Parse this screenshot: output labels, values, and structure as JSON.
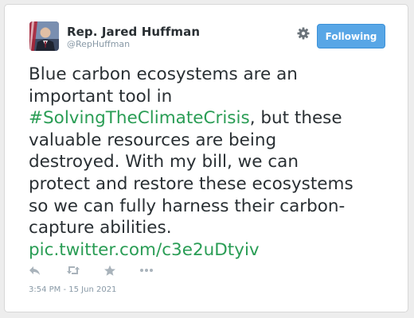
{
  "tweet": {
    "author": {
      "display_name": "Rep. Jared Huffman",
      "handle": "@RepHuffman",
      "avatar_icon": "profile-photo"
    },
    "follow_button_label": "Following",
    "settings_icon": "gear-icon",
    "text_lines": [
      {
        "text": "Blue carbon ecosystems are an"
      },
      {
        "text": "important tool in"
      },
      {
        "link": "#SolvingTheClimateCrisis",
        "text": ", but these"
      },
      {
        "text": "valuable resources are being"
      },
      {
        "text": "destroyed. With my bill, we can"
      },
      {
        "text": "protect and restore these ecosystems"
      },
      {
        "text": "so we can fully harness their carbon-"
      },
      {
        "text": "capture abilities."
      },
      {
        "link": "pic.twitter.com/c3e2uDtyiv"
      }
    ],
    "actions": [
      "reply-icon",
      "retweet-icon",
      "favorite-icon",
      "more-icon"
    ],
    "timestamp": "3:54 PM - 15 Jun 2021"
  },
  "colors": {
    "link": "#2a9d55",
    "follow_button": "#58a6e6",
    "text": "#292f33",
    "muted": "#8899a6"
  }
}
